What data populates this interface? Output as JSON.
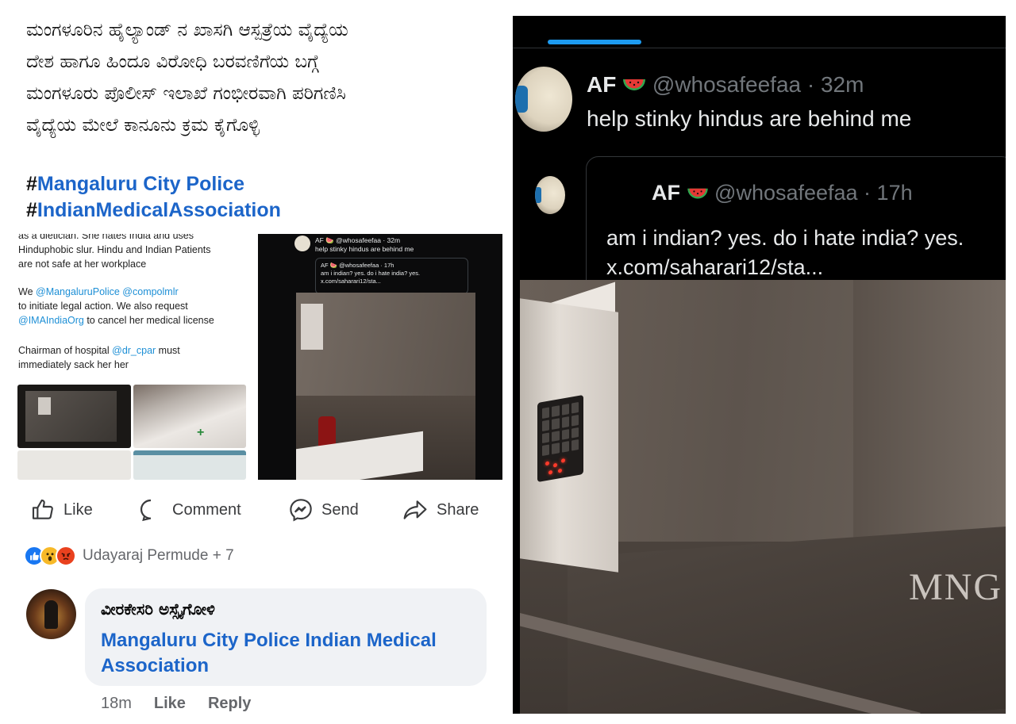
{
  "facebook_post": {
    "kannada_lines": [
      "ಮಂಗಳೂರಿನ ಹೈಲ್ಯಾಂಡ್ ನ ಖಾಸಗಿ ಆಸ್ಪತ್ರೆಯ ವೈದ್ಯೆಯ",
      "ದೇಶ ಹಾಗೂ ಹಿಂದೂ ವಿರೋಧಿ ಬರವಣಿಗೆಯ ಬಗ್ಗೆ",
      "ಮಂಗಳೂರು ಪೊಲೀಸ್ ಇಲಾಖೆ ಗಂಭೀರವಾಗಿ ಪರಿಗಣಿಸಿ",
      "ವೈದ್ಯೆಯ ಮೇಲೆ ಕಾನೂನು ಕ್ರಮ ಕೈಗೊಳ್ಳಿ"
    ],
    "hashtags": [
      {
        "hash": "#",
        "tag": "Mangaluru City Police"
      },
      {
        "hash": "#",
        "tag": "IndianMedicalAssociation"
      }
    ],
    "embedded": {
      "text_lines": [
        "as a dietician. She hates India and uses",
        "Hinduphobic slur. Hindu and Indian Patients",
        "are not safe at her workplace"
      ],
      "we_line": {
        "prefix": "We ",
        "mention1": "@MangaluruPolice",
        "space": " ",
        "mention2": "@compolmlr"
      },
      "action_line": "to initiate legal action. We also request",
      "ima_line": {
        "mention": "@IMAIndiaOrg",
        "suffix": " to cancel her medical license"
      },
      "chairman_line": {
        "prefix": "Chairman of hospital ",
        "mention": "@dr_cpar",
        "suffix": " must"
      },
      "sack_line": "immediately sack her her",
      "mini_tweet": {
        "head": "AF 🍉 @whosafeefaa · 32m",
        "body": "help stinky hindus are behind me",
        "quote_head": "AF 🍉 @whosafeefaa · 17h",
        "quote_line1": "am i indian? yes. do i hate india? yes.",
        "quote_line2": "x.com/saharari12/sta..."
      }
    },
    "actions": {
      "like": "Like",
      "comment": "Comment",
      "send": "Send",
      "share": "Share"
    },
    "reactions": {
      "names": "Udayaraj Permude + 7"
    },
    "comment": {
      "author": "ವೀರಕೇಸರಿ ಅಸ್ಸೈಗೋಳಿ",
      "text": "Mangaluru City Police Indian Medical Association",
      "time": "18m",
      "like": "Like",
      "reply": "Reply"
    }
  },
  "tweet": {
    "name": "AF",
    "handle_time": "@whosafeefaa · 32m",
    "body": "help stinky hindus are behind me",
    "quote": {
      "name": "AF",
      "handle_time": "@whosafeefaa · 17h",
      "line1": "am i indian? yes. do i hate india? yes.",
      "line2": "x.com/saharari12/sta..."
    },
    "watermark": "MNG"
  },
  "colors": {
    "link_blue": "#1c65c9",
    "twitter_blue": "#1d9bf0",
    "twitter_bg": "#000000",
    "muted": "#71767b"
  },
  "icons": [
    "thumbs-up-icon",
    "comment-icon",
    "messenger-icon",
    "share-icon",
    "watermelon-icon"
  ]
}
